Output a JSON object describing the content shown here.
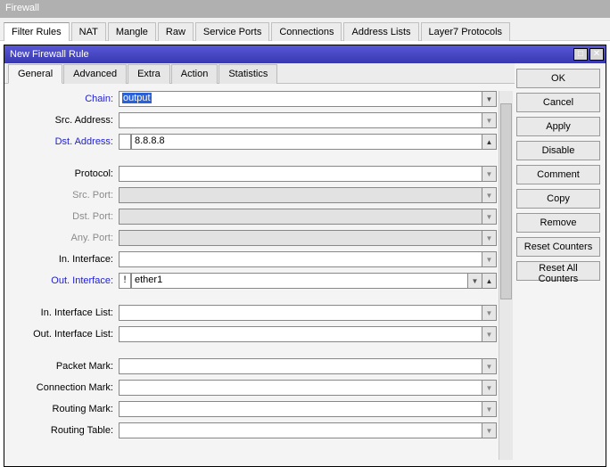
{
  "outerTitle": "Firewall",
  "mainTabs": [
    "Filter Rules",
    "NAT",
    "Mangle",
    "Raw",
    "Service Ports",
    "Connections",
    "Address Lists",
    "Layer7 Protocols"
  ],
  "mainTabActive": 0,
  "innerTitle": "New Firewall Rule",
  "innerTabs": [
    "General",
    "Advanced",
    "Extra",
    "Action",
    "Statistics"
  ],
  "innerTabActive": 0,
  "sideButtons": [
    "OK",
    "Cancel",
    "Apply",
    "Disable",
    "Comment",
    "Copy",
    "Remove",
    "Reset Counters",
    "Reset All Counters"
  ],
  "fields": {
    "chain": {
      "label": "Chain:",
      "value": "output",
      "blue": true,
      "enabled": true,
      "hasDropdown": true,
      "hasUpArrow": false,
      "highlighted": true
    },
    "srcAddress": {
      "label": "Src. Address:",
      "value": "",
      "blue": false,
      "enabled": true,
      "hasDropdown": false,
      "hasUpArrow": false,
      "triOpen": true
    },
    "dstAddress": {
      "label": "Dst. Address:",
      "value": "8.8.8.8",
      "blue": true,
      "enabled": true,
      "hasDropdown": false,
      "hasUpArrow": true,
      "hasNegate": true
    },
    "protocol": {
      "label": "Protocol:",
      "value": "",
      "blue": false,
      "enabled": true,
      "hasDropdown": false,
      "triOpen": true
    },
    "srcPort": {
      "label": "Src. Port:",
      "value": "",
      "blue": false,
      "enabled": false,
      "triOpen": true
    },
    "dstPort": {
      "label": "Dst. Port:",
      "value": "",
      "blue": false,
      "enabled": false,
      "triOpen": true
    },
    "anyPort": {
      "label": "Any. Port:",
      "value": "",
      "blue": false,
      "enabled": false,
      "triOpen": true
    },
    "inInterface": {
      "label": "In. Interface:",
      "value": "",
      "blue": false,
      "enabled": true,
      "triOpen": true
    },
    "outInterface": {
      "label": "Out. Interface:",
      "value": "ether1",
      "blue": true,
      "enabled": true,
      "hasDropdown": true,
      "hasUpArrow": true,
      "hasNegate": true,
      "negateText": "!"
    },
    "inInterfaceList": {
      "label": "In. Interface List:",
      "value": "",
      "blue": false,
      "enabled": true,
      "triOpen": true
    },
    "outInterfaceList": {
      "label": "Out. Interface List:",
      "value": "",
      "blue": false,
      "enabled": true,
      "triOpen": true
    },
    "packetMark": {
      "label": "Packet Mark:",
      "value": "",
      "blue": false,
      "enabled": true,
      "triOpen": true
    },
    "connectionMark": {
      "label": "Connection Mark:",
      "value": "",
      "blue": false,
      "enabled": true,
      "triOpen": true
    },
    "routingMark": {
      "label": "Routing Mark:",
      "value": "",
      "blue": false,
      "enabled": true,
      "triOpen": true
    },
    "routingTable": {
      "label": "Routing Table:",
      "value": "",
      "blue": false,
      "enabled": true,
      "triOpen": true
    }
  },
  "fieldOrder": [
    "chain",
    "srcAddress",
    "dstAddress",
    "__gap",
    "protocol",
    "srcPort",
    "dstPort",
    "anyPort",
    "inInterface",
    "outInterface",
    "__gap",
    "inInterfaceList",
    "outInterfaceList",
    "__gap",
    "packetMark",
    "connectionMark",
    "routingMark",
    "routingTable"
  ]
}
